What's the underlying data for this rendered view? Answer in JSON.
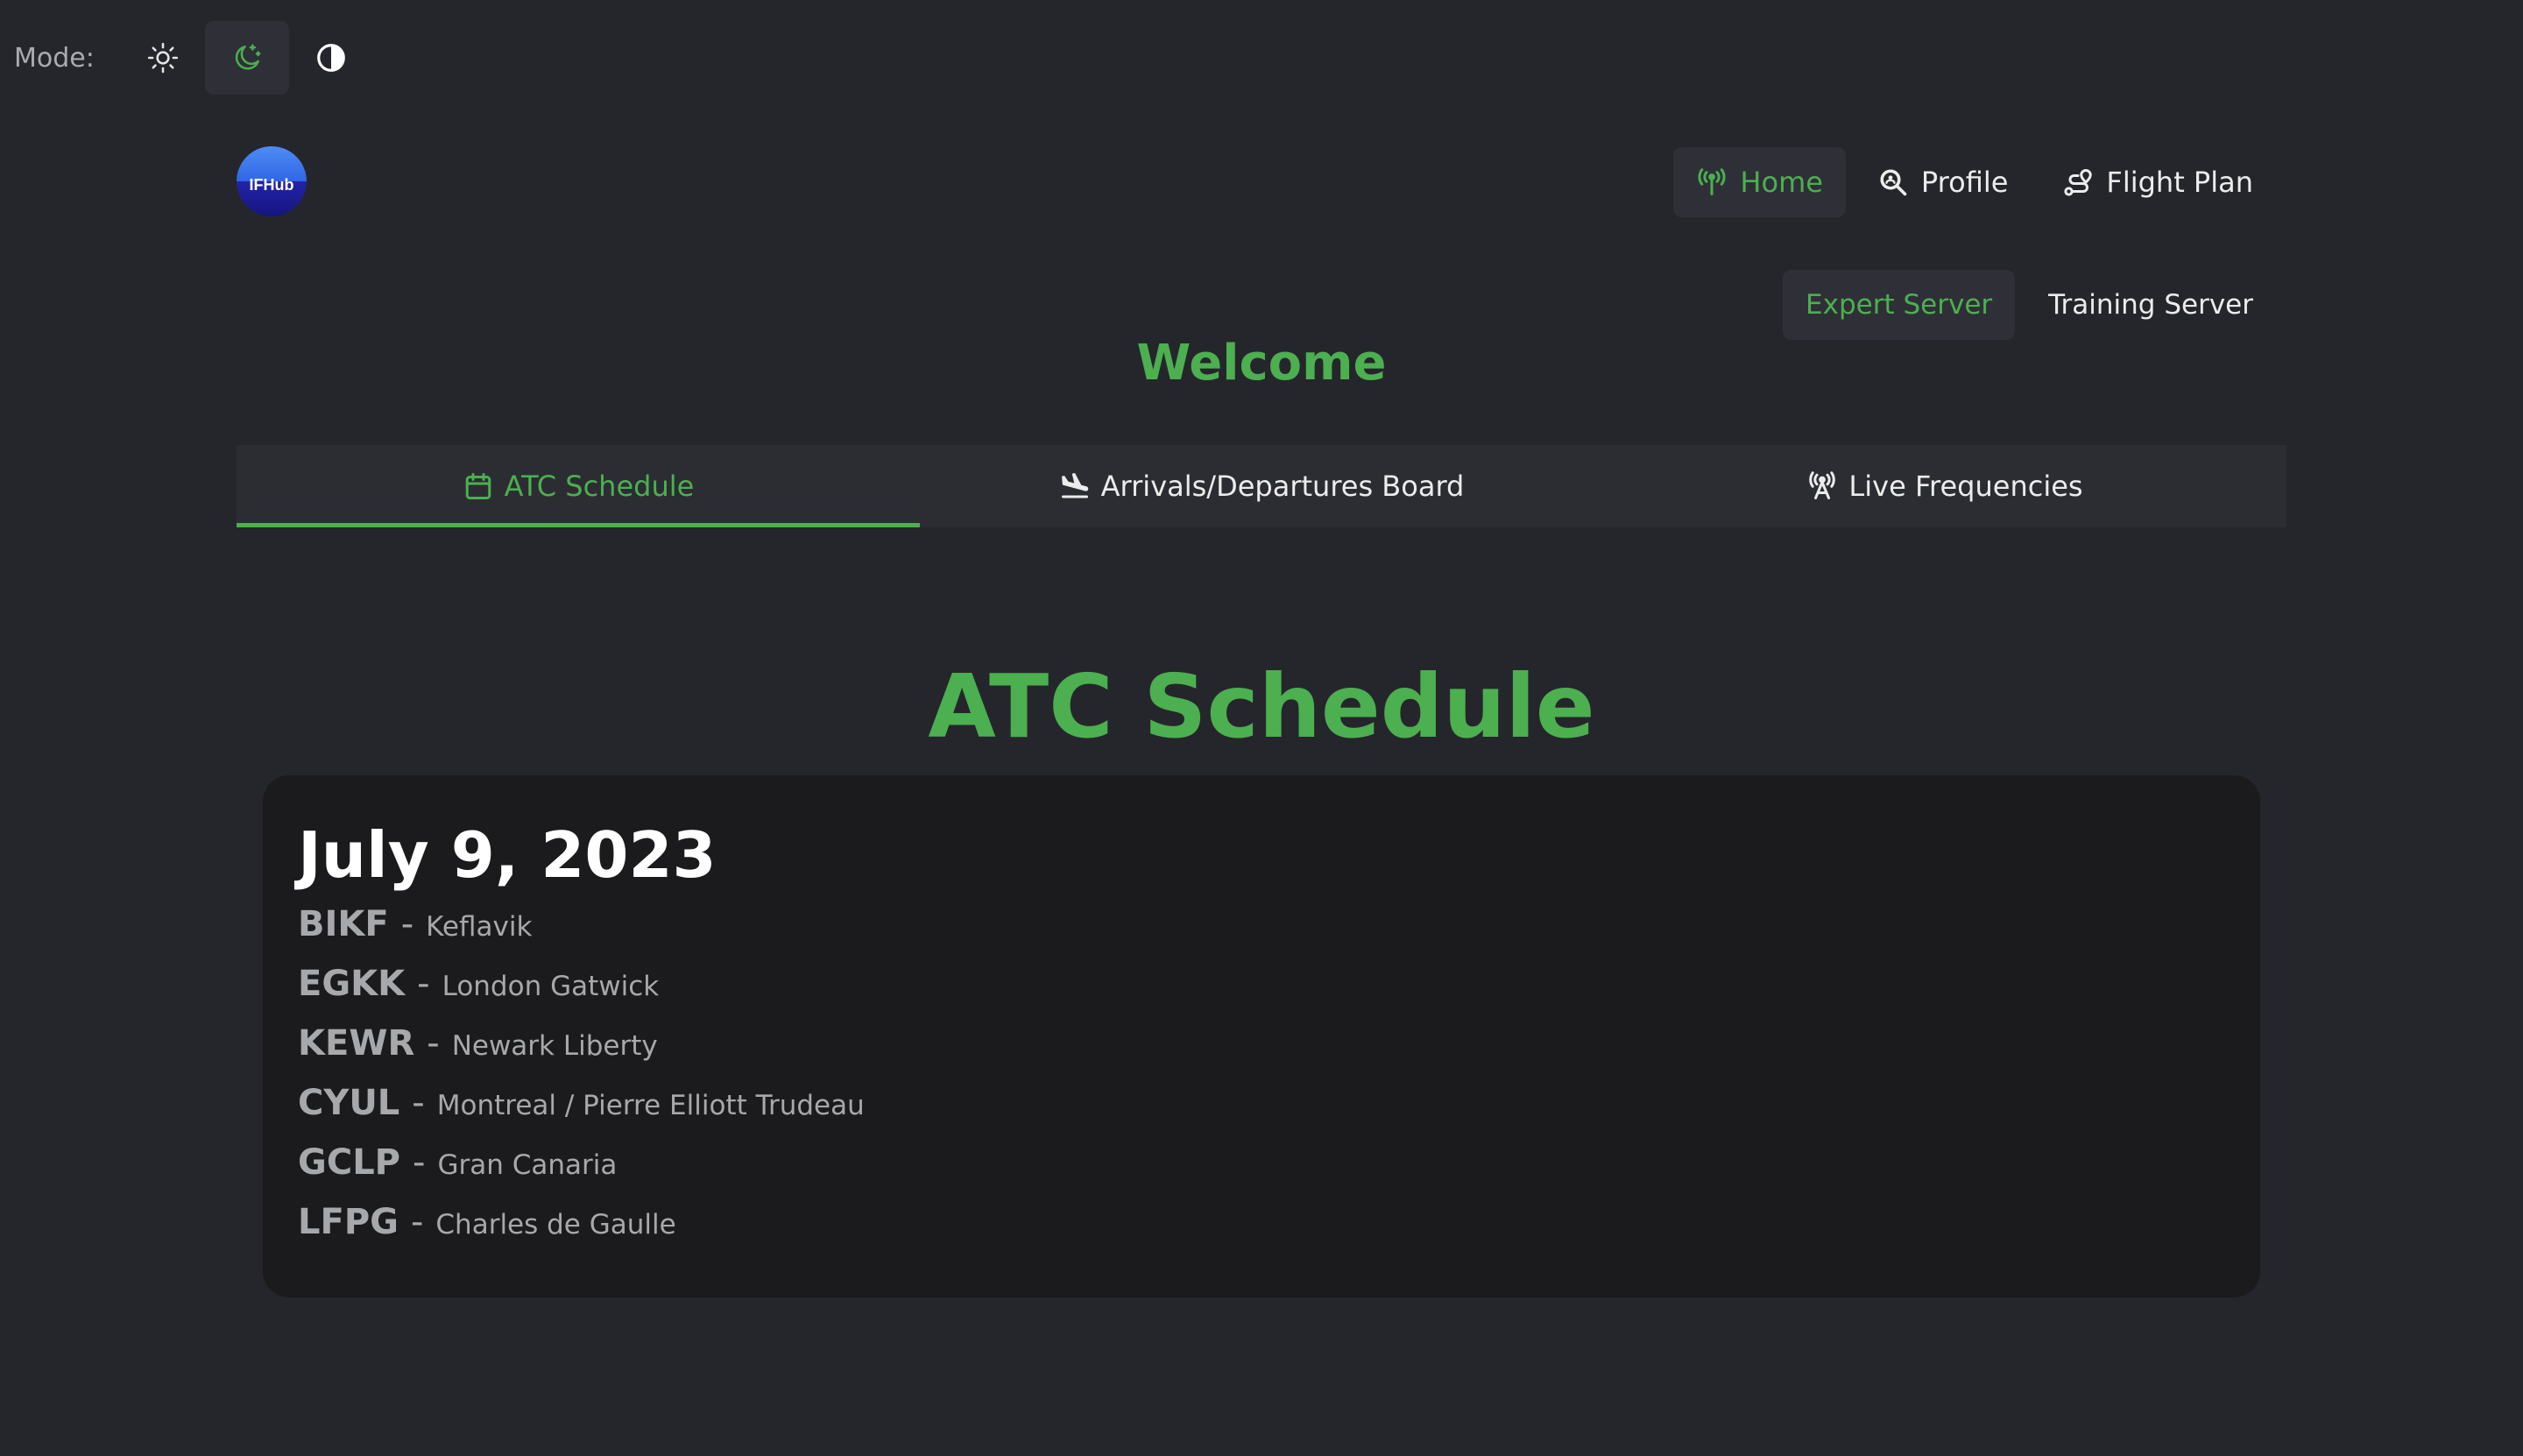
{
  "mode_bar": {
    "label": "Mode:",
    "options": [
      {
        "icon": "sun-icon",
        "active": false
      },
      {
        "icon": "moon-icon",
        "active": true
      },
      {
        "icon": "contrast-icon",
        "active": false
      }
    ]
  },
  "logo": {
    "text": "IFHub"
  },
  "nav": {
    "items": [
      {
        "label": "Home",
        "icon": "antenna-icon",
        "active": true
      },
      {
        "label": "Profile",
        "icon": "search-user-icon",
        "active": false
      },
      {
        "label": "Flight Plan",
        "icon": "route-icon",
        "active": false
      }
    ]
  },
  "servers": {
    "items": [
      {
        "label": "Expert Server",
        "active": true
      },
      {
        "label": "Training Server",
        "active": false
      }
    ]
  },
  "welcome": "Welcome",
  "tabs": [
    {
      "label": "ATC Schedule",
      "icon": "calendar-icon",
      "active": true
    },
    {
      "label": "Arrivals/Departures Board",
      "icon": "plane-landing-icon",
      "active": false
    },
    {
      "label": "Live Frequencies",
      "icon": "radio-tower-icon",
      "active": false
    }
  ],
  "section_title": "ATC Schedule",
  "schedule": {
    "date": "July 9, 2023",
    "airports": [
      {
        "code": "BIKF",
        "sep": "-",
        "name": "Keflavik"
      },
      {
        "code": "EGKK",
        "sep": "-",
        "name": "London Gatwick"
      },
      {
        "code": "KEWR",
        "sep": "-",
        "name": "Newark Liberty"
      },
      {
        "code": "CYUL",
        "sep": "-",
        "name": "Montreal / Pierre Elliott Trudeau"
      },
      {
        "code": "GCLP",
        "sep": "-",
        "name": "Gran Canaria"
      },
      {
        "code": "LFPG",
        "sep": "-",
        "name": "Charles de Gaulle"
      }
    ]
  },
  "colors": {
    "accent": "#4caf50",
    "background": "#25262b",
    "card": "#1b1b1d"
  }
}
